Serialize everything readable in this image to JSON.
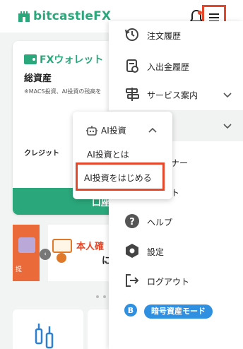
{
  "header": {
    "brand": "bitcastleFX",
    "brand_color": "#2aa87b",
    "bell_icon": "bell-icon",
    "menu_icon": "hamburger-icon"
  },
  "wallet_card": {
    "title": "FXウォレット",
    "total_assets_label": "総資産",
    "note": "※MACS投資、AI投資の残高を",
    "credit_label": "クレジット",
    "button_label": "口座"
  },
  "banner": {
    "left_label": "提",
    "main_title": "本人確",
    "main_sub": "に"
  },
  "side_menu": {
    "items": [
      {
        "label": "注文履歴",
        "icon": "history-icon"
      },
      {
        "label": "入出金履歴",
        "icon": "deposit-history-icon"
      },
      {
        "label": "サービス案内",
        "icon": "signpost-icon"
      },
      {
        "label": "",
        "icon": "",
        "expanded": true
      },
      {
        "label": "トナー",
        "icon": ""
      },
      {
        "label": "ント",
        "icon": ""
      },
      {
        "label": "ヘルプ",
        "icon": "help-icon"
      },
      {
        "label": "設定",
        "icon": "settings-icon"
      },
      {
        "label": "ログアウト",
        "icon": "logout-icon"
      }
    ],
    "crypto_mode_label": "暗号資産モード"
  },
  "ai_submenu": {
    "header_label": "AI投資",
    "items": [
      "AI投資とは",
      "AI投資をはじめる"
    ]
  }
}
